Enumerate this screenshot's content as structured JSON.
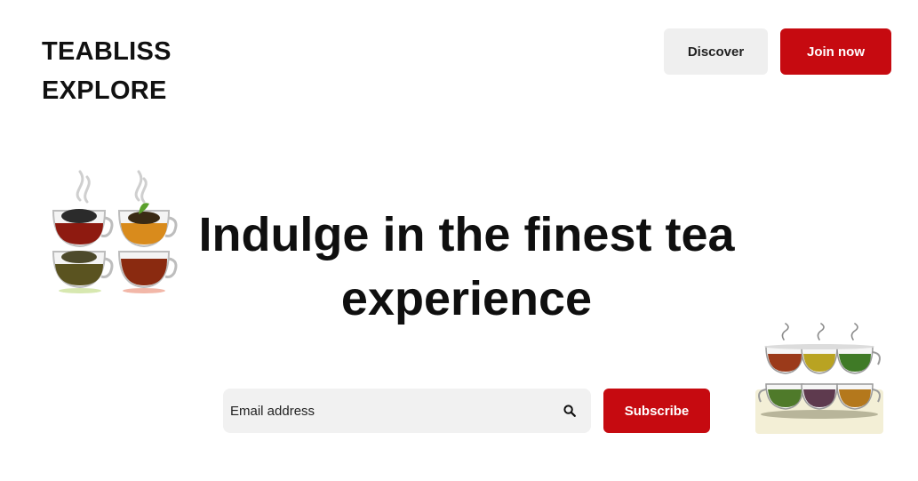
{
  "brand": {
    "line1": "TEABLISS",
    "line2": "EXPLORE"
  },
  "nav": {
    "discover_label": "Discover",
    "join_label": "Join now"
  },
  "hero": {
    "headline": "Indulge in the finest tea experience"
  },
  "subscribe": {
    "email_placeholder": "Email address",
    "button_label": "Subscribe"
  },
  "colors": {
    "accent": "#c60a10",
    "secondary_button": "#efefef",
    "input_bg": "#f1f1f1"
  },
  "icons": {
    "search": "search-icon",
    "tea_left": "tea-cups-illustration",
    "tea_right": "tea-cups-illustration"
  }
}
